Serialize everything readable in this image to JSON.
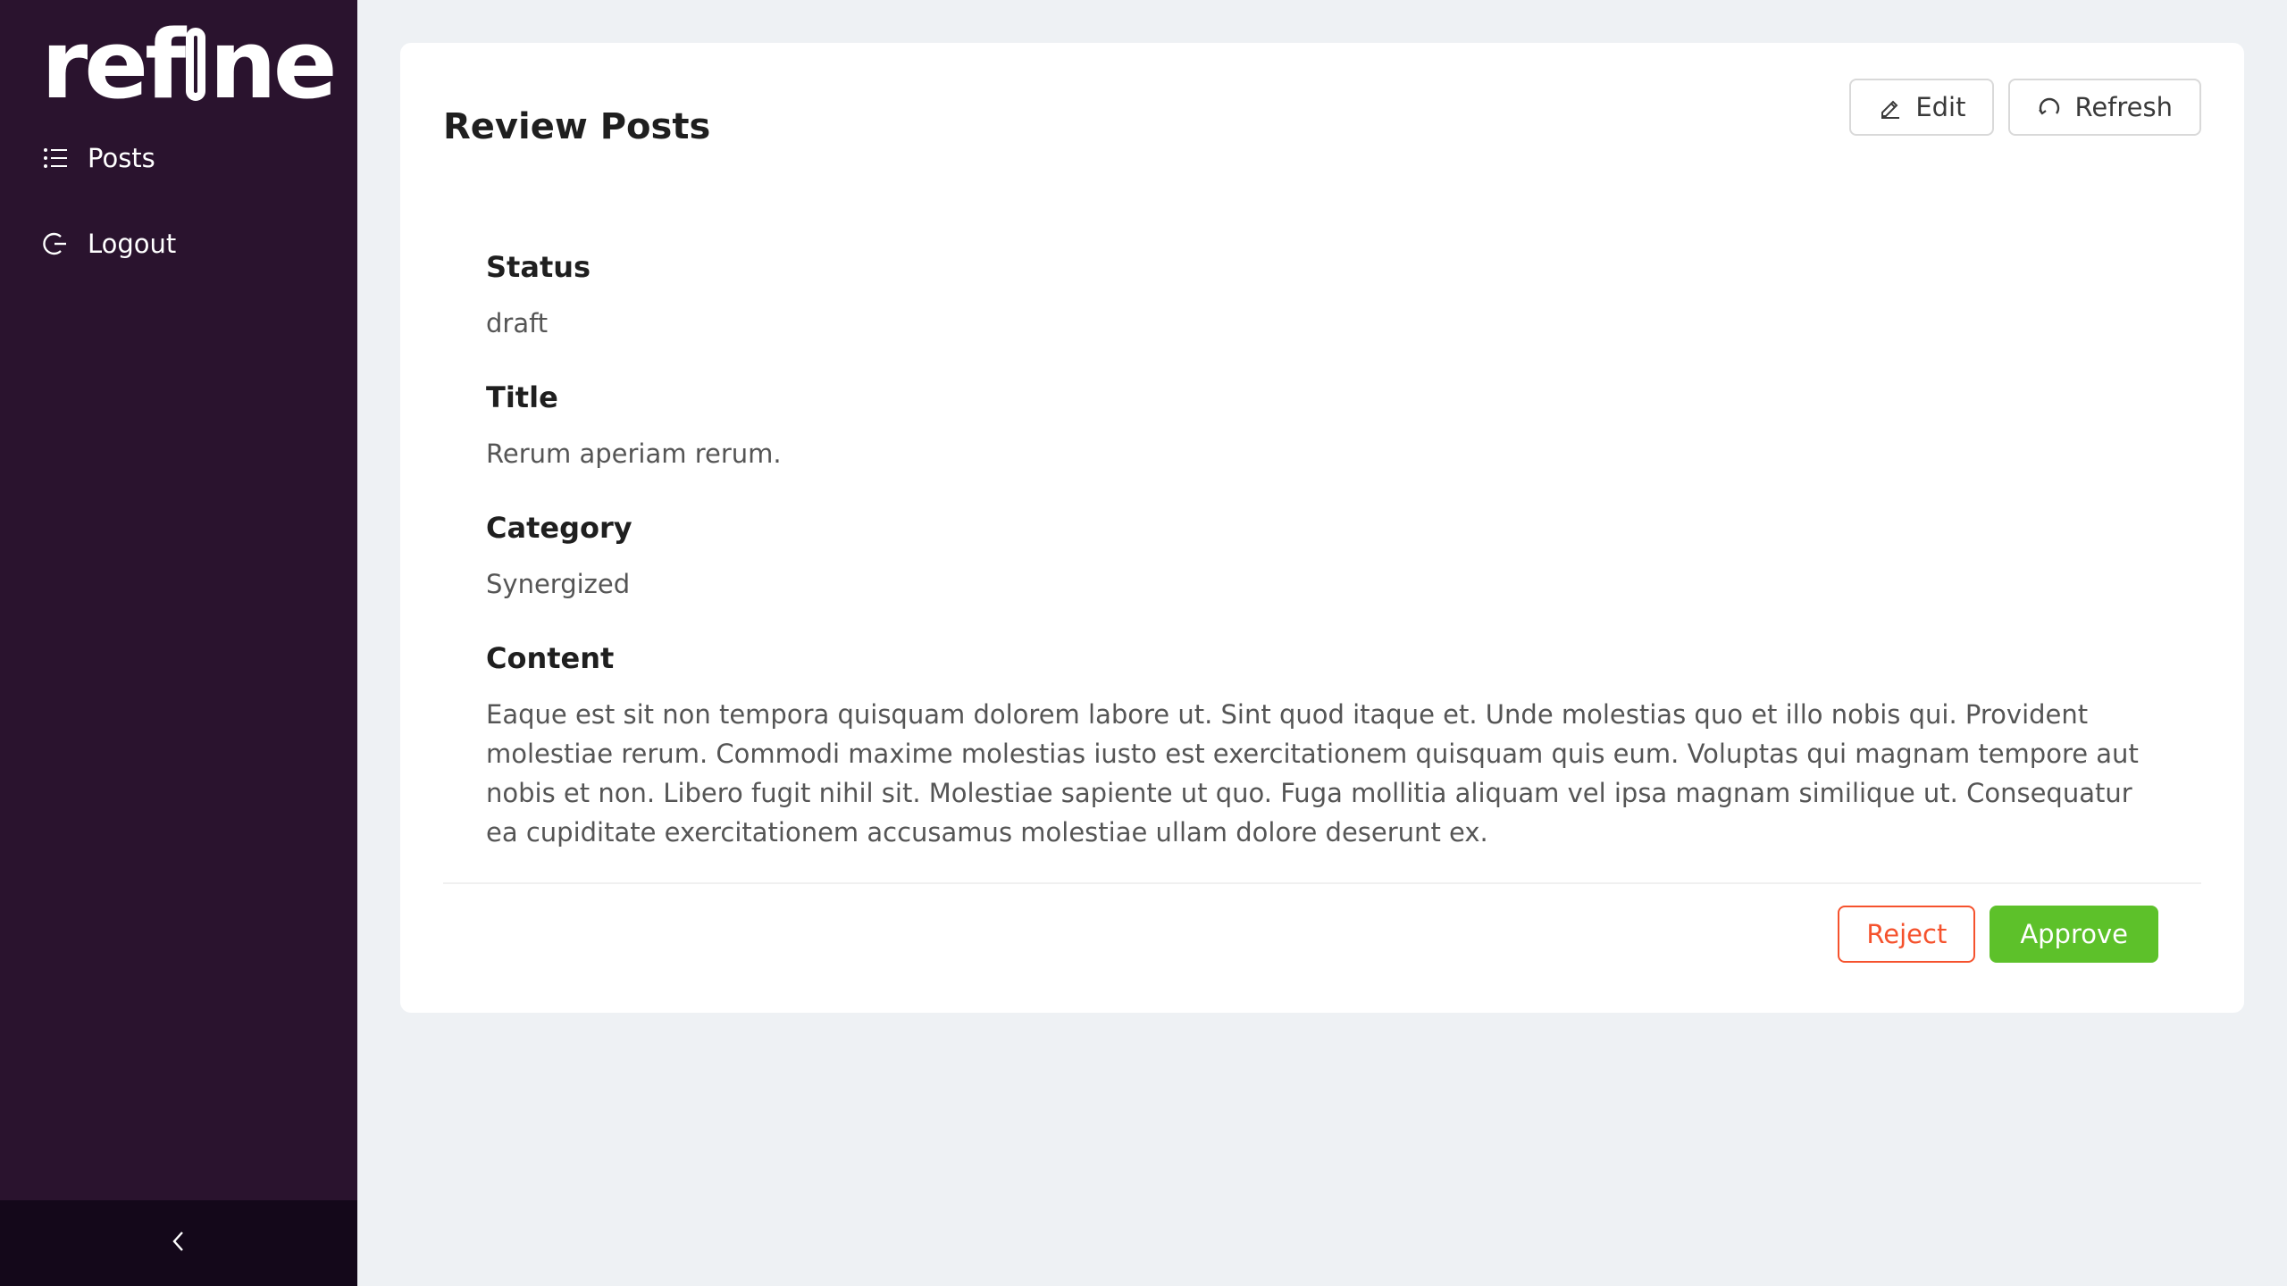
{
  "sidebar": {
    "logo_text_left": "ref",
    "logo_text_right": "ne",
    "items": [
      {
        "label": "Posts",
        "icon": "list-icon"
      },
      {
        "label": "Logout",
        "icon": "logout-icon"
      }
    ],
    "collapse_icon": "chevron-left-icon",
    "background": "#2a132e"
  },
  "header": {
    "title": "Review Posts",
    "edit_label": "Edit",
    "refresh_label": "Refresh"
  },
  "fields": [
    {
      "label": "Status",
      "value": "draft"
    },
    {
      "label": "Title",
      "value": "Rerum aperiam rerum."
    },
    {
      "label": "Category",
      "value": "Synergized"
    },
    {
      "label": "Content",
      "value": "Eaque est sit non tempora quisquam dolorem labore ut. Sint quod itaque et. Unde molestias quo et illo nobis qui. Provident molestiae rerum. Commodi maxime molestias iusto est exercitationem quisquam quis eum. Voluptas qui magnam tempore aut nobis et non. Libero fugit nihil sit. Molestiae sapiente ut quo. Fuga mollitia aliquam vel ipsa magnam similique ut. Consequatur ea cupiditate exercitationem accusamus molestiae ullam dolore deserunt ex."
    }
  ],
  "footer": {
    "reject_label": "Reject",
    "approve_label": "Approve"
  },
  "colors": {
    "reject": "#f5522d",
    "approve": "#5dc12a"
  }
}
